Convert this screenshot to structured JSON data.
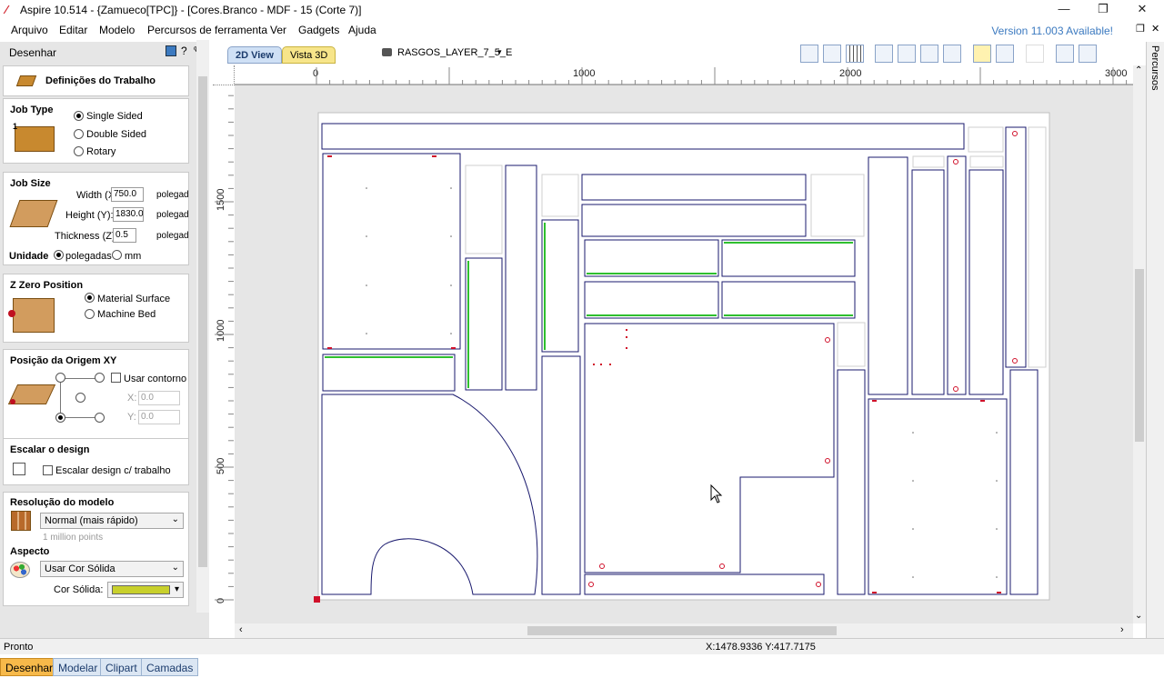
{
  "app": {
    "title": "Aspire 10.514 - {Zamueco[TPC]} - [Cores.Branco - MDF - 15 (Corte 7)]",
    "version_notice": "Version 11.003 Available!"
  },
  "menu": [
    "Arquivo",
    "Editar",
    "Modelo",
    "Percursos de ferramenta",
    "Ver",
    "Gadgets",
    "Ajuda"
  ],
  "left_panel": {
    "title": "Desenhar",
    "job_setup_title": "Definições do Trabalho",
    "job_type": {
      "header": "Job Type",
      "options": [
        "Single Sided",
        "Double Sided",
        "Rotary"
      ],
      "selected": "Single Sided"
    },
    "job_size": {
      "header": "Job Size",
      "width_label": "Width (X)",
      "width_value": "750.0",
      "height_label": "Height (Y):",
      "height_value": "1830.0",
      "thickness_label": "Thickness (Z):",
      "thickness_value": "0.5",
      "unit_suffix": "polegadas",
      "unit_label": "Unidade",
      "unit_options": [
        "polegadas",
        "mm"
      ],
      "unit_selected": "polegadas"
    },
    "z_zero": {
      "header": "Z Zero Position",
      "options": [
        "Material Surface",
        "Machine Bed"
      ],
      "selected": "Material Surface"
    },
    "origin": {
      "header": "Posição da Origem XY",
      "use_offset_label": "Usar contorno",
      "x_label": "X:",
      "x_value": "0.0",
      "y_label": "Y:",
      "y_value": "0.0"
    },
    "scale": {
      "header": "Escalar o design",
      "checkbox_label": "Escalar design c/ trabalho"
    },
    "resolution": {
      "header": "Resolução do modelo",
      "value": "Normal (mais rápido)",
      "hint": "1 million points"
    },
    "appearance": {
      "header": "Aspecto",
      "value": "Usar Cor Sólida",
      "color_label": "Cor Sólida:",
      "color_hex": "#c8d02c"
    },
    "bottom_tabs": [
      "Desenhar",
      "Modelar",
      "Clipart",
      "Camadas"
    ],
    "active_tab": "Desenhar"
  },
  "view_tabs": [
    "2D View",
    "Vista 3D"
  ],
  "layer_selector": "RASGOS_LAYER_7_5_E",
  "ruler": {
    "top_labels": [
      "0",
      "1000",
      "2000",
      "3000"
    ],
    "left_labels": [
      "1500",
      "1000",
      "500",
      "0"
    ]
  },
  "right_tab": "Percursos",
  "status": {
    "left": "Pronto",
    "coords": "X:1478.9336 Y:417.7175"
  },
  "colors": {
    "accent_blue": "#3c7ac0",
    "active_tab_orange": "#f7b94a",
    "vector_stroke": "#1a1a6e",
    "groove_green": "#2fbf2f",
    "hole_red": "#d0102a"
  }
}
